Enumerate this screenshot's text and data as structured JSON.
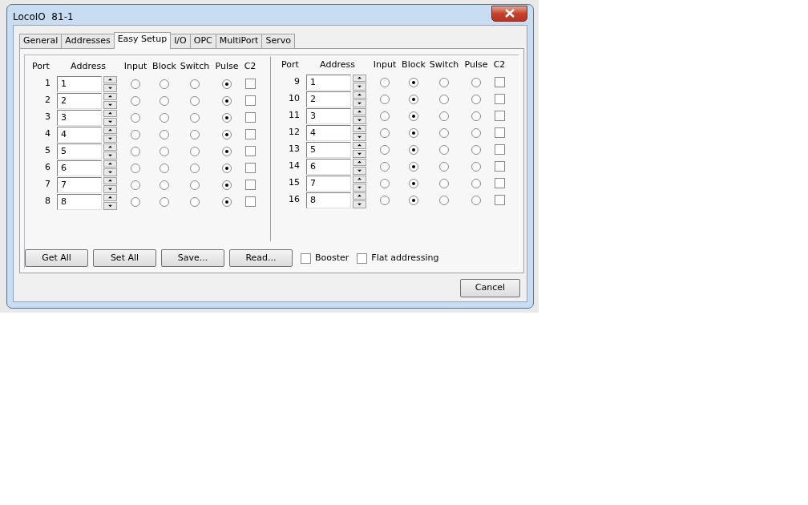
{
  "window": {
    "title": "LocoIO  81-1"
  },
  "tabs": [
    {
      "label": "General",
      "selected": false
    },
    {
      "label": "Addresses",
      "selected": false
    },
    {
      "label": "Easy Setup",
      "selected": true
    },
    {
      "label": "I/O",
      "selected": false
    },
    {
      "label": "OPC",
      "selected": false
    },
    {
      "label": "MultiPort",
      "selected": false
    },
    {
      "label": "Servo",
      "selected": false
    }
  ],
  "port_groups": [
    {
      "headers": [
        "Port",
        "Address",
        "Input",
        "Block",
        "Switch",
        "Pulse",
        "C2"
      ],
      "ports": [
        {
          "port": "1",
          "address": "1",
          "modes": [
            {
              "selected": false
            },
            {
              "selected": false
            },
            {
              "selected": false
            },
            {
              "selected": true
            }
          ],
          "c2": false
        },
        {
          "port": "2",
          "address": "2",
          "modes": [
            {
              "selected": false
            },
            {
              "selected": false
            },
            {
              "selected": false
            },
            {
              "selected": true
            }
          ],
          "c2": false
        },
        {
          "port": "3",
          "address": "3",
          "modes": [
            {
              "selected": false
            },
            {
              "selected": false
            },
            {
              "selected": false
            },
            {
              "selected": true
            }
          ],
          "c2": false
        },
        {
          "port": "4",
          "address": "4",
          "modes": [
            {
              "selected": false
            },
            {
              "selected": false
            },
            {
              "selected": false
            },
            {
              "selected": true
            }
          ],
          "c2": false
        },
        {
          "port": "5",
          "address": "5",
          "modes": [
            {
              "selected": false
            },
            {
              "selected": false
            },
            {
              "selected": false
            },
            {
              "selected": true
            }
          ],
          "c2": false
        },
        {
          "port": "6",
          "address": "6",
          "modes": [
            {
              "selected": false
            },
            {
              "selected": false
            },
            {
              "selected": false
            },
            {
              "selected": true
            }
          ],
          "c2": false
        },
        {
          "port": "7",
          "address": "7",
          "modes": [
            {
              "selected": false
            },
            {
              "selected": false
            },
            {
              "selected": false
            },
            {
              "selected": true
            }
          ],
          "c2": false
        },
        {
          "port": "8",
          "address": "8",
          "modes": [
            {
              "selected": false
            },
            {
              "selected": false
            },
            {
              "selected": false
            },
            {
              "selected": true
            }
          ],
          "c2": false
        }
      ]
    },
    {
      "headers": [
        "Port",
        "Address",
        "Input",
        "Block",
        "Switch",
        "Pulse",
        "C2"
      ],
      "ports": [
        {
          "port": "9",
          "address": "1",
          "modes": [
            {
              "selected": false
            },
            {
              "selected": true
            },
            {
              "selected": false
            },
            {
              "selected": false
            }
          ],
          "c2": false
        },
        {
          "port": "10",
          "address": "2",
          "modes": [
            {
              "selected": false
            },
            {
              "selected": true
            },
            {
              "selected": false
            },
            {
              "selected": false
            }
          ],
          "c2": false
        },
        {
          "port": "11",
          "address": "3",
          "modes": [
            {
              "selected": false
            },
            {
              "selected": true
            },
            {
              "selected": false
            },
            {
              "selected": false
            }
          ],
          "c2": false
        },
        {
          "port": "12",
          "address": "4",
          "modes": [
            {
              "selected": false
            },
            {
              "selected": true
            },
            {
              "selected": false
            },
            {
              "selected": false
            }
          ],
          "c2": false
        },
        {
          "port": "13",
          "address": "5",
          "modes": [
            {
              "selected": false
            },
            {
              "selected": true
            },
            {
              "selected": false
            },
            {
              "selected": false
            }
          ],
          "c2": false
        },
        {
          "port": "14",
          "address": "6",
          "modes": [
            {
              "selected": false
            },
            {
              "selected": true
            },
            {
              "selected": false
            },
            {
              "selected": false
            }
          ],
          "c2": false
        },
        {
          "port": "15",
          "address": "7",
          "modes": [
            {
              "selected": false
            },
            {
              "selected": true
            },
            {
              "selected": false
            },
            {
              "selected": false
            }
          ],
          "c2": false
        },
        {
          "port": "16",
          "address": "8",
          "modes": [
            {
              "selected": false
            },
            {
              "selected": true
            },
            {
              "selected": false
            },
            {
              "selected": false
            }
          ],
          "c2": false
        }
      ]
    }
  ],
  "actions": [
    "Get All",
    "Set All",
    "Save...",
    "Read..."
  ],
  "options": [
    {
      "label": "Booster",
      "checked": false
    },
    {
      "label": "Flat addressing",
      "checked": false
    }
  ],
  "buttons": [
    "Cancel"
  ]
}
